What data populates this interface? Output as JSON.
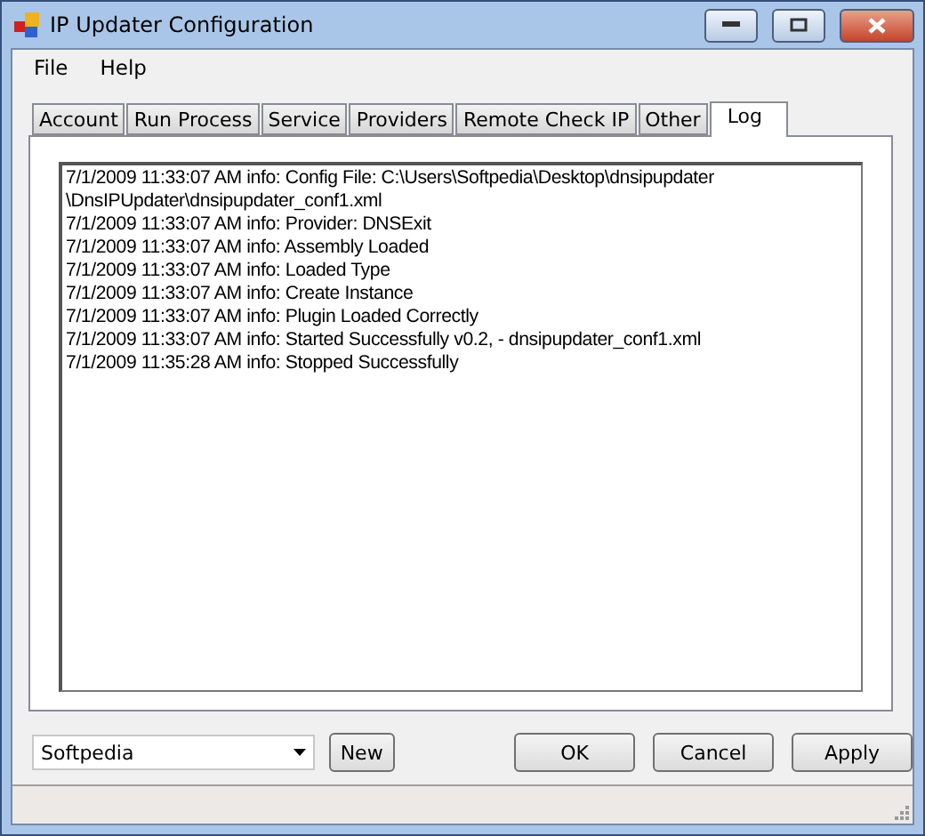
{
  "window": {
    "title": "IP Updater Configuration"
  },
  "menu": [
    "File",
    "Help"
  ],
  "tabs": [
    {
      "label": "Account",
      "selected": false
    },
    {
      "label": "Run Process",
      "selected": false
    },
    {
      "label": "Service",
      "selected": false
    },
    {
      "label": "Providers",
      "selected": false
    },
    {
      "label": "Remote Check IP",
      "selected": false
    },
    {
      "label": "Other",
      "selected": false
    },
    {
      "label": "Log",
      "selected": true
    }
  ],
  "log_lines": [
    "7/1/2009 11:33:07 AM info: Config File: C:\\Users\\Softpedia\\Desktop\\dnsipupdater",
    "\\DnsIPUpdater\\dnsipupdater_conf1.xml",
    "7/1/2009 11:33:07 AM info: Provider: DNSExit",
    "7/1/2009 11:33:07 AM info: Assembly Loaded",
    "7/1/2009 11:33:07 AM info: Loaded Type",
    "7/1/2009 11:33:07 AM info: Create Instance",
    "7/1/2009 11:33:07 AM info: Plugin Loaded Correctly",
    "7/1/2009 11:33:07 AM info: Started Successfully v0.2, - dnsipupdater_conf1.xml",
    "7/1/2009 11:35:28 AM info: Stopped Successfully"
  ],
  "profile": {
    "value": "Softpedia"
  },
  "new_button": "New",
  "buttons": [
    "OK",
    "Cancel",
    "Apply"
  ]
}
